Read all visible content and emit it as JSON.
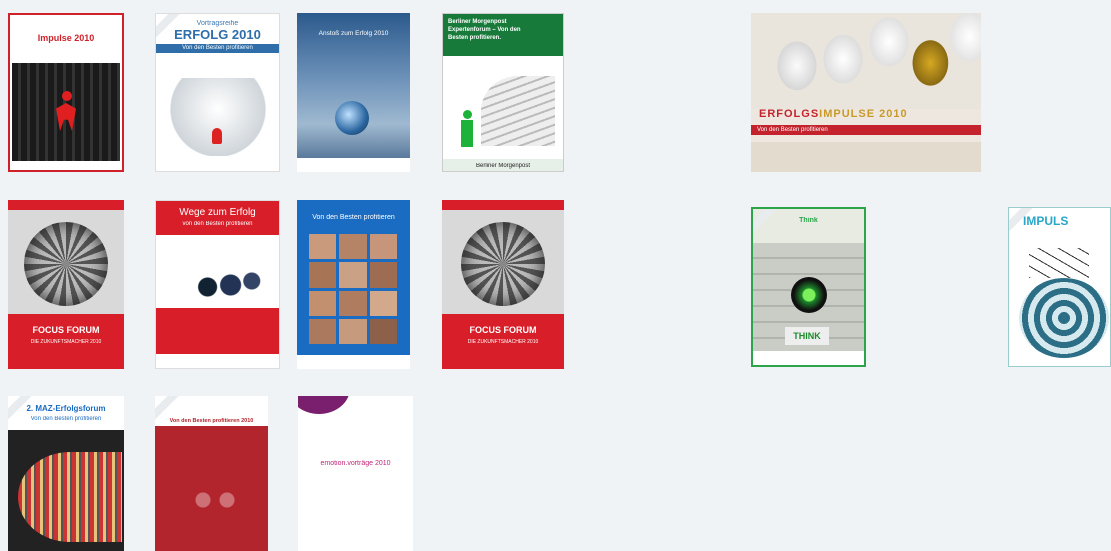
{
  "grid_left": [
    {
      "name": "thumb-1",
      "title": "Impulse 2010"
    },
    {
      "name": "thumb-2",
      "title": "Vortragsreihe",
      "title2": "ERFOLG 2010",
      "subtitle": "Von den Besten profitieren"
    },
    {
      "name": "thumb-3",
      "title": "Anstoß zum Erfolg 2010"
    },
    {
      "name": "thumb-4",
      "title": "Berliner Morgenpost Expertenforum – Von den Besten profitieren.",
      "footer": "Berliner Morgenpost"
    },
    {
      "name": "thumb-5",
      "title": "FOCUS FORUM",
      "subtitle": "DIE ZUKUNFTSMACHER 2010"
    },
    {
      "name": "thumb-6",
      "title": "Wege zum Erfolg",
      "subtitle": "von den Besten profitieren"
    },
    {
      "name": "thumb-7",
      "title": "Von den Besten profitieren"
    },
    {
      "name": "thumb-8",
      "title": "FOCUS FORUM",
      "subtitle": "DIE ZUKUNFTSMACHER 2010"
    },
    {
      "name": "thumb-9",
      "title": "2. MAZ-Erfolgsforum",
      "subtitle": "Von den Besten profitieren"
    },
    {
      "name": "thumb-10",
      "title": "Von den Besten profitieren 2010"
    },
    {
      "name": "thumb-11",
      "title": "emotion.vorträge 2010"
    }
  ],
  "featured": {
    "title_prefix": "ERFOLGS",
    "title_suffix": "IMPULSE 2010",
    "subtitle": "Von den Besten profitieren"
  },
  "right_thumbs": [
    {
      "name": "thumb-think",
      "title": "Think",
      "badge": "THINK"
    },
    {
      "name": "thumb-impuls",
      "title": "IMPULS"
    }
  ]
}
